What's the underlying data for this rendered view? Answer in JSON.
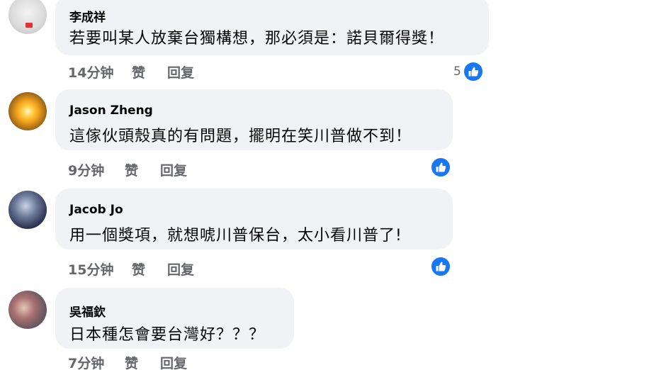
{
  "comments": [
    {
      "author": "李成祥",
      "text": "若要叫某人放棄台獨構想，那必須是：諾貝爾得獎！",
      "time": "14分钟",
      "like_label": "赞",
      "reply_label": "回复",
      "reaction_count": "5"
    },
    {
      "author": "Jason Zheng",
      "text": "這傢伙頭殼真的有問題，擺明在笑川普做不到！",
      "time": "9分钟",
      "like_label": "赞",
      "reply_label": "回复"
    },
    {
      "author": "Jacob Jo",
      "text": "用一個獎項，就想唬川普保台，太小看川普了!",
      "time": "15分钟",
      "like_label": "赞",
      "reply_label": "回复"
    },
    {
      "author": "吳福欽",
      "text": "日本種怎會要台灣好？？？",
      "time": "7分钟",
      "like_label": "赞",
      "reply_label": "回复"
    }
  ],
  "icons": {
    "reaction": "thumbs-up-icon"
  },
  "colors": {
    "reaction_blue": "#1877f2",
    "bubble": "#f0f2f5",
    "meta_text": "#65676b"
  }
}
